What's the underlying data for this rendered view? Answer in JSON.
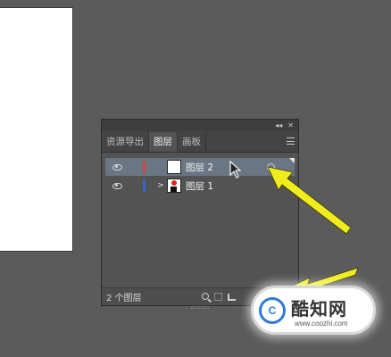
{
  "panel": {
    "topbar": {
      "collapse_glyph": "◂◂",
      "close_glyph": "✕"
    },
    "tabs": [
      {
        "label": "资源导出",
        "active": false
      },
      {
        "label": "图层",
        "active": true
      },
      {
        "label": "画板",
        "active": false
      }
    ],
    "menu_icon": "hamburger-menu-icon"
  },
  "layers": [
    {
      "name": "图层 2",
      "color": "#d0463c",
      "selected": true,
      "expandable": false,
      "visible": true
    },
    {
      "name": "图层 1",
      "color": "#3a62c9",
      "selected": false,
      "expandable": true,
      "visible": true
    }
  ],
  "footer": {
    "count_label": "2 个图层",
    "icons": [
      "search-icon",
      "square-icon",
      "clip-icon"
    ]
  },
  "watermark": {
    "logo_text": "C",
    "brand": "酷知网",
    "url": "www.coozhi.com"
  },
  "annotation": {
    "color": "#f1ec1c"
  }
}
